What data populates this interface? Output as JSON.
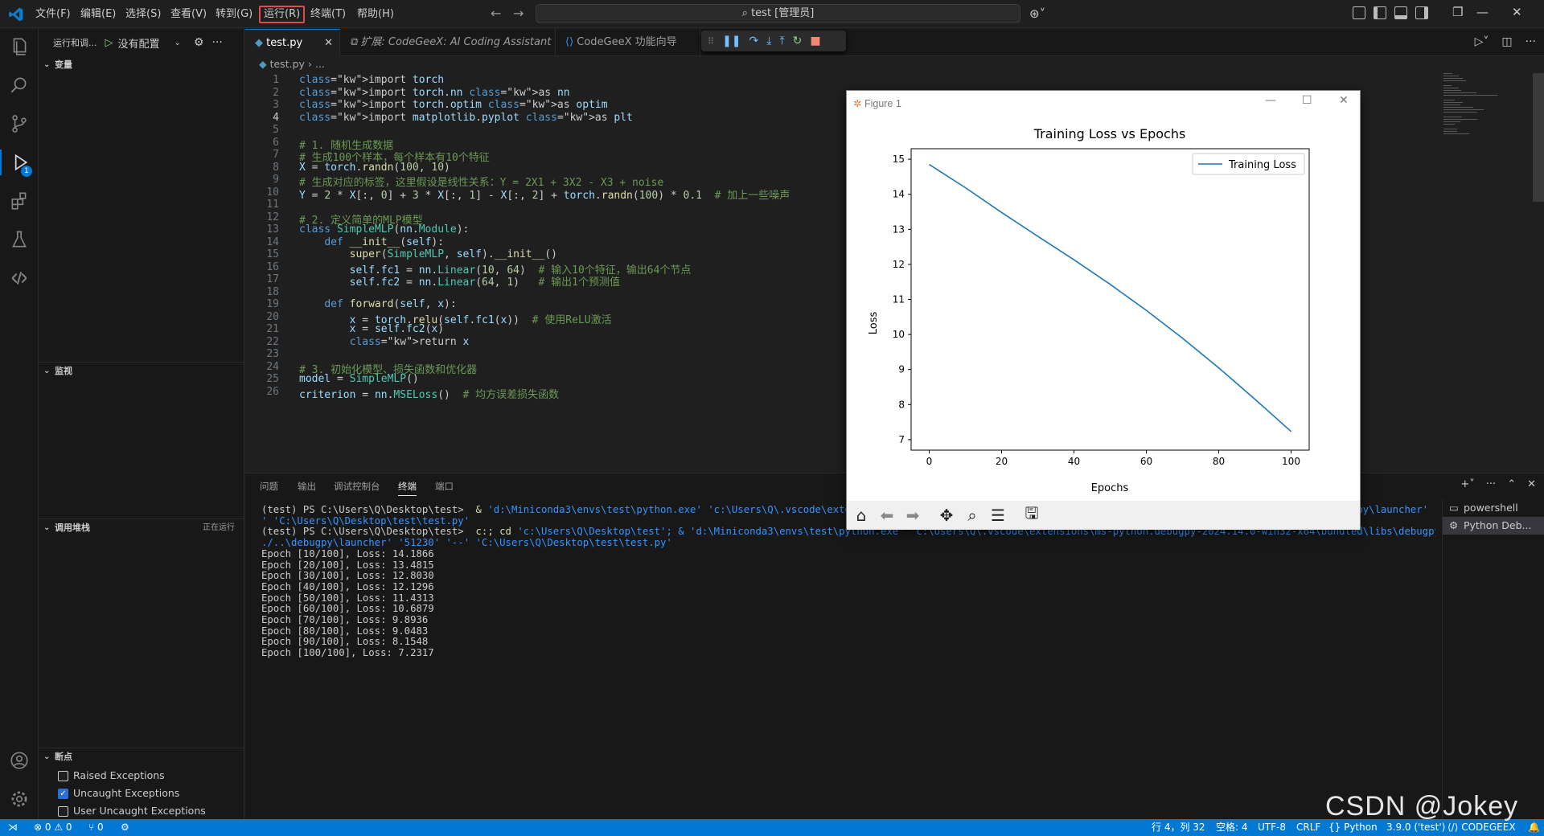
{
  "titlebar": {
    "menus": [
      "文件(F)",
      "编辑(E)",
      "选择(S)",
      "查看(V)",
      "转到(G)",
      "运行(R)",
      "终端(T)",
      "帮助(H)"
    ],
    "highlighted_menu": "运行(R)",
    "search": "test [管理员]"
  },
  "sidebar": {
    "run_label": "运行和调...",
    "config": "没有配置",
    "sections": {
      "variables": "变量",
      "watch": "监视",
      "callstack": "调用堆栈",
      "callstack_status": "正在运行",
      "breakpoints": "断点"
    },
    "breakpoints": [
      {
        "label": "Raised Exceptions",
        "checked": false
      },
      {
        "label": "Uncaught Exceptions",
        "checked": true
      },
      {
        "label": "User Uncaught Exceptions",
        "checked": false
      }
    ],
    "debug_badge": "1"
  },
  "tabs": [
    {
      "label": "test.py",
      "active": true
    },
    {
      "label": "扩展: CodeGeeX: AI Coding Assistant",
      "active": false
    },
    {
      "label": "CodeGeeX 功能向导",
      "active": false
    }
  ],
  "breadcrumb": {
    "file": "test.py",
    "rest": "..."
  },
  "editor": {
    "current_line": 4,
    "lines": [
      "import torch",
      "import torch.nn as nn",
      "import torch.optim as optim",
      "import matplotlib.pyplot as plt",
      "",
      "# 1. 随机生成数据",
      "# 生成100个样本，每个样本有10个特征",
      "X = torch.randn(100, 10)",
      "# 生成对应的标签，这里假设是线性关系：Y = 2X1 + 3X2 - X3 + noise",
      "Y = 2 * X[:, 0] + 3 * X[:, 1] - X[:, 2] + torch.randn(100) * 0.1  # 加上一些噪声",
      "",
      "# 2. 定义简单的MLP模型",
      "class SimpleMLP(nn.Module):",
      "    def __init__(self):",
      "        super(SimpleMLP, self).__init__()",
      "        self.fc1 = nn.Linear(10, 64)  # 输入10个特征，输出64个节点",
      "        self.fc2 = nn.Linear(64, 1)   # 输出1个预测值",
      "",
      "    def forward(self, x):",
      "        x = torch.relu(self.fc1(x))  # 使用ReLU激活",
      "        x = self.fc2(x)",
      "        return x",
      "",
      "# 3. 初始化模型、损失函数和优化器",
      "model = SimpleMLP()",
      "criterion = nn.MSELoss()  # 均方误差损失函数"
    ]
  },
  "figure": {
    "window_title": "Figure 1",
    "chart_data": {
      "type": "line",
      "title": "Training Loss vs Epochs",
      "xlabel": "Epochs",
      "ylabel": "Loss",
      "xlim": [
        -5,
        105
      ],
      "ylim": [
        6.7,
        15.3
      ],
      "xticks": [
        0,
        20,
        40,
        60,
        80,
        100
      ],
      "yticks": [
        7,
        8,
        9,
        10,
        11,
        12,
        13,
        14,
        15
      ],
      "legend": "upper right",
      "series": [
        {
          "name": "Training Loss",
          "color": "#1f77b4",
          "x": [
            0,
            10,
            20,
            30,
            40,
            50,
            60,
            70,
            80,
            90,
            100
          ],
          "y": [
            14.85,
            14.1866,
            13.4815,
            12.803,
            12.1296,
            11.4313,
            10.6879,
            9.8936,
            9.0483,
            8.1548,
            7.2317
          ]
        }
      ]
    }
  },
  "panel": {
    "tabs": [
      "问题",
      "输出",
      "调试控制台",
      "终端",
      "端口"
    ],
    "active_tab": "终端",
    "terminals": [
      "powershell",
      "Python Deb..."
    ],
    "lines": [
      {
        "prompt": "(test) PS C:\\Users\\Q\\Desktop\\test>  ",
        "cmd": "& ",
        "args": "'d:\\Miniconda3\\envs\\test\\python.exe' 'c:\\Users\\Q\\.vscode\\extensions\\ms-python.debugpy-2024.14.0-win32-x64\\bundled\\libs\\debugpy\\adapter/../..\\debugpy\\launcher' '51194' '--"
      },
      {
        "prompt": "",
        "cmd": "",
        "args": "' 'C:\\Users\\Q\\Desktop\\test\\test.py'"
      },
      {
        "prompt": "(test) PS C:\\Users\\Q\\Desktop\\test>  ",
        "cmd": "c:; cd ",
        "args": "'c:\\Users\\Q\\Desktop\\test'; & 'd:\\Miniconda3\\envs\\test\\python.exe' 'c:\\Users\\Q\\.vscode\\extensions\\ms-python.debugpy-2024.14.0-win32-x64\\bundled\\libs\\debugpy\\adapter/."
      },
      {
        "prompt": "",
        "cmd": "",
        "args": "./..\\debugpy\\launcher' '51230' '--' 'C:\\Users\\Q\\Desktop\\test\\test.py'"
      },
      {
        "prompt": "",
        "cmd": "Epoch [10/100], Loss: 14.1866",
        "args": ""
      },
      {
        "prompt": "",
        "cmd": "Epoch [20/100], Loss: 13.4815",
        "args": ""
      },
      {
        "prompt": "",
        "cmd": "Epoch [30/100], Loss: 12.8030",
        "args": ""
      },
      {
        "prompt": "",
        "cmd": "Epoch [40/100], Loss: 12.1296",
        "args": ""
      },
      {
        "prompt": "",
        "cmd": "Epoch [50/100], Loss: 11.4313",
        "args": ""
      },
      {
        "prompt": "",
        "cmd": "Epoch [60/100], Loss: 10.6879",
        "args": ""
      },
      {
        "prompt": "",
        "cmd": "Epoch [70/100], Loss: 9.8936",
        "args": ""
      },
      {
        "prompt": "",
        "cmd": "Epoch [80/100], Loss: 9.0483",
        "args": ""
      },
      {
        "prompt": "",
        "cmd": "Epoch [90/100], Loss: 8.1548",
        "args": ""
      },
      {
        "prompt": "",
        "cmd": "Epoch [100/100], Loss: 7.2317",
        "args": ""
      }
    ]
  },
  "statusbar": {
    "errors": "0",
    "warnings": "0",
    "ports": "0",
    "position": "行 4，列 32",
    "spaces": "空格: 4",
    "encoding": "UTF-8",
    "eol": "CRLF",
    "language": "Python",
    "interpreter": "3.9.0 ('test')",
    "codegeex": "CODEGEEX"
  },
  "watermark": "CSDN @Jokey"
}
